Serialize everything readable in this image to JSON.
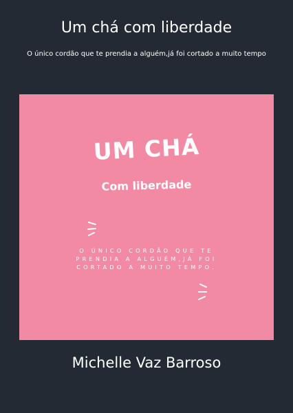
{
  "cover": {
    "title": "Um chá com liberdade",
    "subtitle": "O único cordão que te prendia a alguém,já foi cortado a muito tempo",
    "author": "Michelle Vaz Barroso",
    "background_color": "#232a34"
  },
  "artwork": {
    "background_color": "#f38aa4",
    "title": "UM CHÁ",
    "subtitle": "Com liberdade",
    "quote_lines": [
      "O ÚNICO CORDÃO QUE TE",
      "PRENDIA A ALGUÉM,JÁ FOI",
      "CORTADO A MUITO TEMPO."
    ],
    "decorations": [
      "sparkle-lines-icon",
      "sparkle-lines-icon"
    ]
  }
}
